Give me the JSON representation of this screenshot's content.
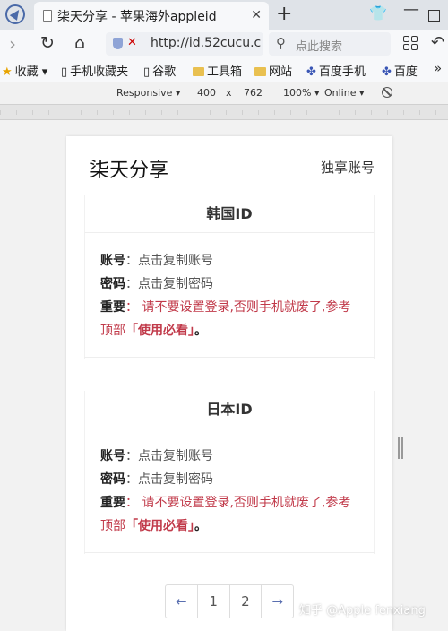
{
  "browser": {
    "tab_title": "柒天分享 - 苹果海外appleid",
    "tab_close": "✕",
    "new_tab": "+",
    "url": "http://id.52cucu.c",
    "search_placeholder": "点此搜索"
  },
  "bookmarks": [
    {
      "icon": "star-icon",
      "label": "收藏"
    },
    {
      "icon": "phone-icon",
      "label": "手机收藏夹"
    },
    {
      "icon": "doc-icon",
      "label": "谷歌"
    },
    {
      "icon": "folder-icon",
      "label": "工具箱"
    },
    {
      "icon": "folder-icon",
      "label": "网站"
    },
    {
      "icon": "paw-icon",
      "label": "百度手机"
    },
    {
      "icon": "paw-icon",
      "label": "百度"
    }
  ],
  "devtools": {
    "device": "Responsive",
    "width": "400",
    "times": "x",
    "height": "762",
    "zoom": "100%",
    "network": "Online"
  },
  "page": {
    "site_title": "柒天分享",
    "header_link": "独享账号",
    "cards": [
      {
        "title": "韩国ID",
        "account_label": "账号",
        "account_value": "：点击复制账号",
        "password_label": "密码",
        "password_value": "：点击复制密码",
        "important_label": "重要",
        "important_text_1": "：  请不要设置登录,否则手机就废了,参考",
        "important_text_2": "顶部",
        "important_link": "「使用必看」",
        "important_end": "。"
      },
      {
        "title": "日本ID",
        "account_label": "账号",
        "account_value": "：点击复制账号",
        "password_label": "密码",
        "password_value": "：点击复制密码",
        "important_label": "重要",
        "important_text_1": "：  请不要设置登录,否则手机就废了,参考",
        "important_text_2": "顶部",
        "important_link": "「使用必看」",
        "important_end": "。"
      }
    ],
    "pagination": {
      "prev": "←",
      "pages": [
        "1",
        "2"
      ],
      "next": "→"
    }
  },
  "watermark": "知乎 @Apple fenxiang"
}
